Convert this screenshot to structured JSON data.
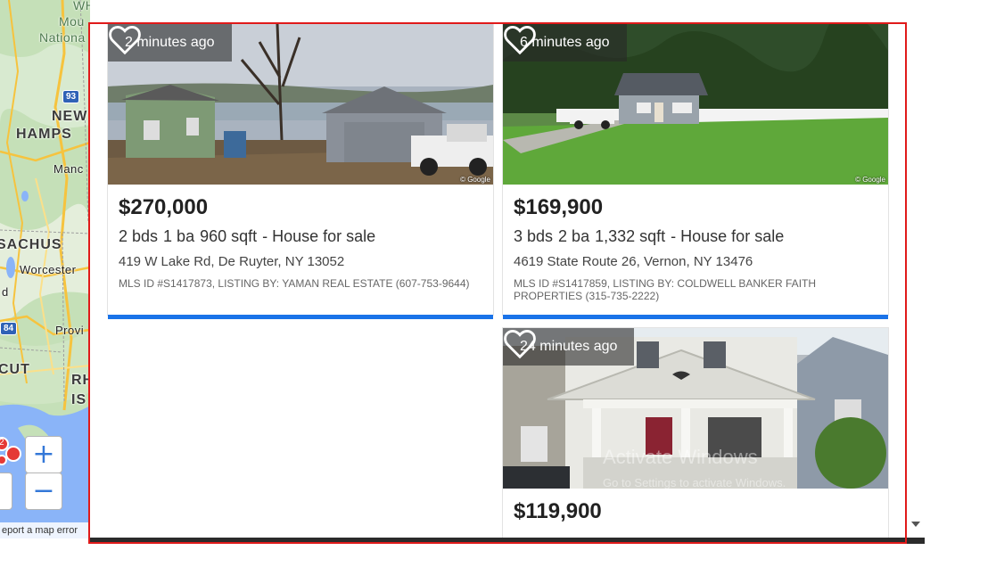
{
  "map": {
    "labels": {
      "wh": "WH",
      "mou": "Mou",
      "national": "Nationa",
      "new": "NEW",
      "hamps": "HAMPS",
      "manc": "Manc",
      "sachus": "SACHUS",
      "worcester": "Worcester",
      "d": "d",
      "provi": "Provi",
      "cut": "CUT",
      "rh": "RH",
      "is": "IS"
    },
    "shields": {
      "i93": "93",
      "i84": "84"
    },
    "cluster_count": "2",
    "zoom_in": "+",
    "zoom_out": "−",
    "report_error": "eport a map error"
  },
  "listings": [
    {
      "time_ago": "2 minutes ago",
      "price": "$270,000",
      "beds": "2 bds",
      "baths": "1 ba",
      "sqft": "960 sqft",
      "type": "- House for sale",
      "address": "419 W Lake Rd, De Ruyter, NY 13052",
      "mls": "MLS ID #S1417873, LISTING BY: YAMAN REAL ESTATE (607-753-9644)",
      "photo_credit": "© Google"
    },
    {
      "time_ago": "6 minutes ago",
      "price": "$169,900",
      "beds": "3 bds",
      "baths": "2 ba",
      "sqft": "1,332 sqft",
      "type": "- House for sale",
      "address": "4619 State Route 26, Vernon, NY 13476",
      "mls": "MLS ID #S1417859, LISTING BY: COLDWELL BANKER FAITH PROPERTIES (315-735-2222)",
      "photo_credit": "© Google"
    },
    {
      "time_ago": "24 minutes ago",
      "price": "$119,900",
      "beds": "",
      "baths": "",
      "sqft": "",
      "type": "",
      "address": "",
      "mls": ""
    }
  ],
  "watermark": {
    "title": "Activate Windows",
    "subtitle": "Go to Settings to activate Windows."
  },
  "colors": {
    "card_bar": "#1a73e8",
    "highlight": "#e01a1a",
    "zoom_icon": "#3478d8"
  }
}
